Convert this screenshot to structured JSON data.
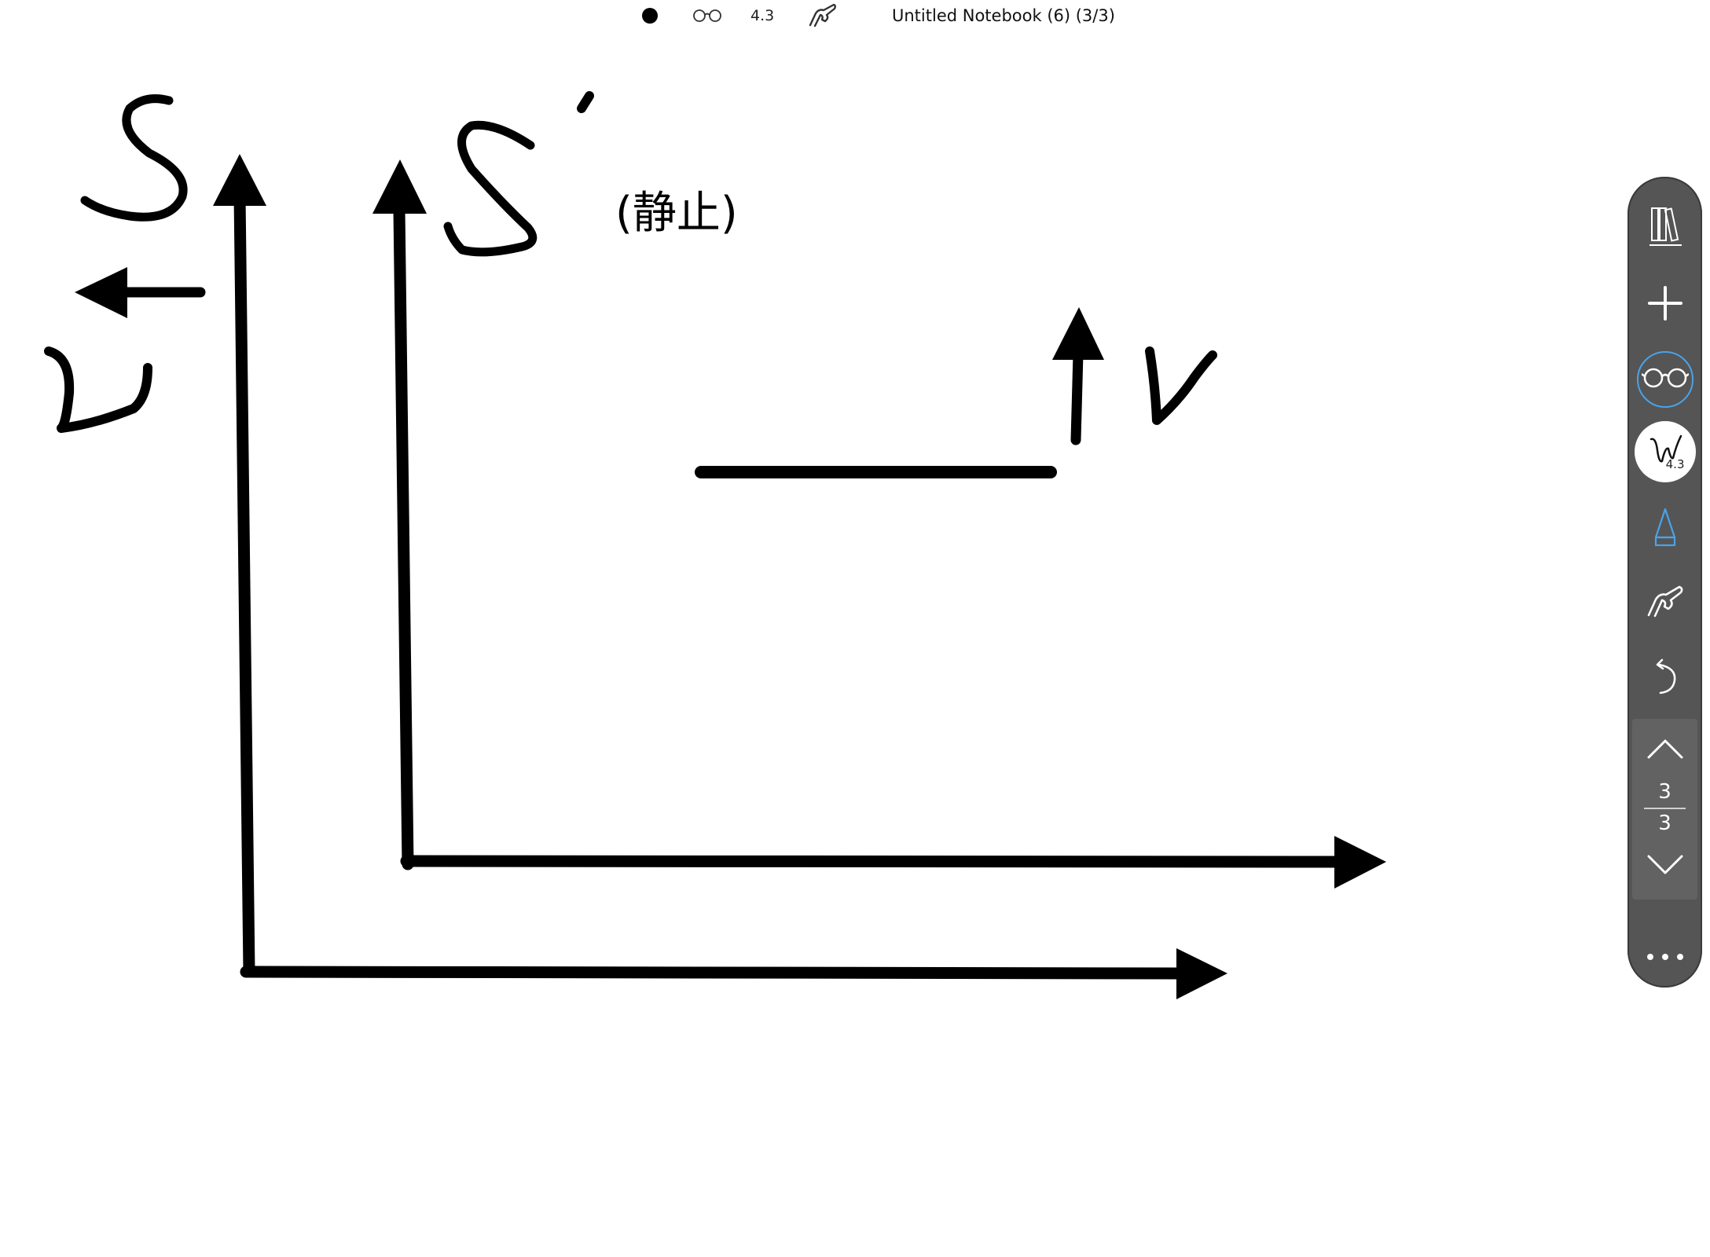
{
  "status_bar": {
    "pen_size": "4.3",
    "title": "Untitled Notebook (6) (3/3)"
  },
  "canvas": {
    "annotation_text": "(静止)"
  },
  "toolbar": {
    "pen_size": "4.3",
    "accent_color": "#4aa3e6",
    "page_current": "3",
    "page_total": "3",
    "icons": [
      "library-icon",
      "add-icon",
      "reading-glasses-icon",
      "pen-icon",
      "pencil-icon",
      "hand-icon",
      "undo-icon",
      "chevron-up-icon",
      "chevron-down-icon",
      "more-icon"
    ]
  }
}
